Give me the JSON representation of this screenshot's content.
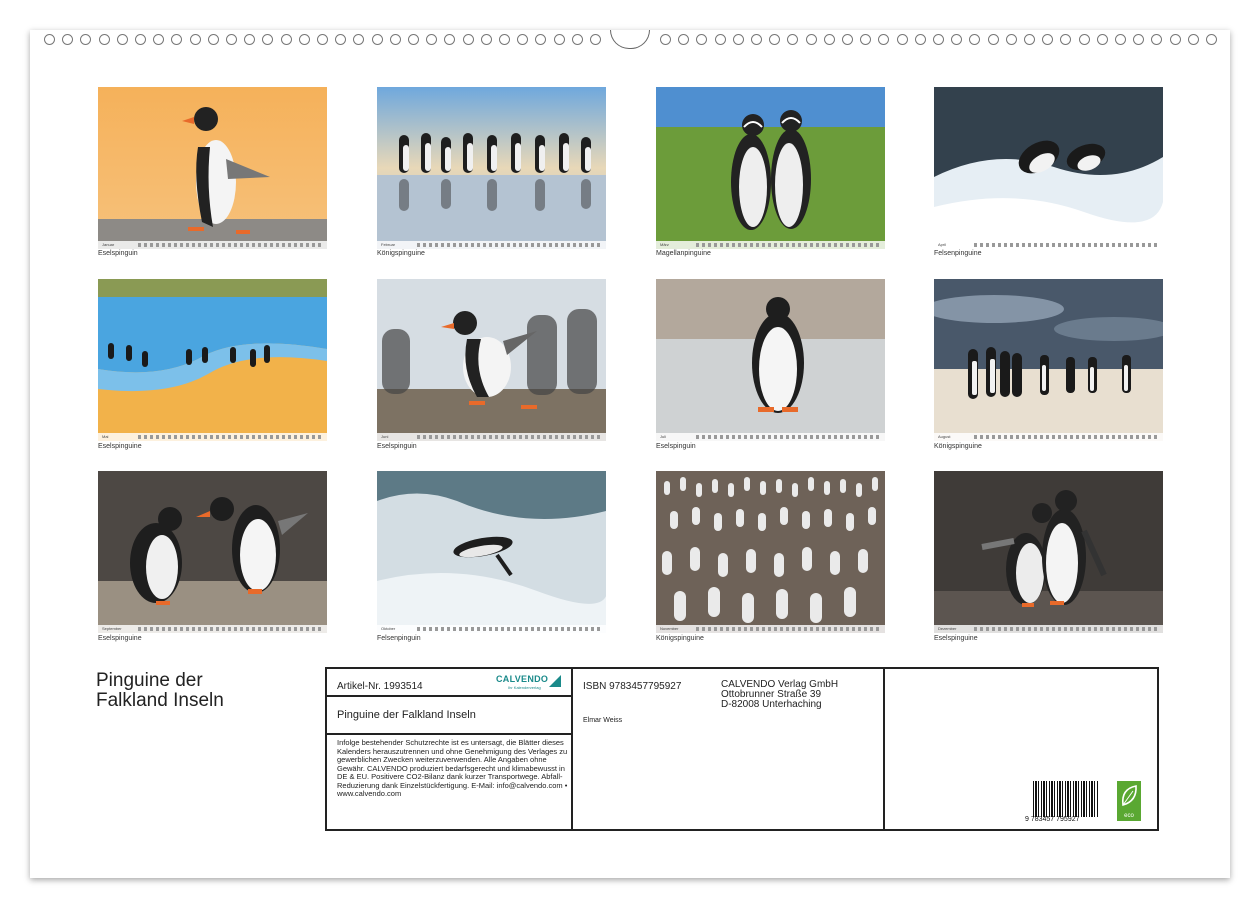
{
  "calendar": {
    "title_line1": "Pinguine der",
    "title_line2": "Falkland Inseln",
    "months": [
      {
        "caption": "Eselspinguin",
        "month": "Januar"
      },
      {
        "caption": "Königspinguine",
        "month": "Februar"
      },
      {
        "caption": "Magellanpinguine",
        "month": "März"
      },
      {
        "caption": "Felsenpinguine",
        "month": "April"
      },
      {
        "caption": "Eselspinguine",
        "month": "Mai"
      },
      {
        "caption": "Eselspinguin",
        "month": "Juni"
      },
      {
        "caption": "Eselspinguin",
        "month": "Juli"
      },
      {
        "caption": "Königspinguine",
        "month": "August"
      },
      {
        "caption": "Eselspinguine",
        "month": "September"
      },
      {
        "caption": "Felsenpinguin",
        "month": "Oktober"
      },
      {
        "caption": "Königspinguine",
        "month": "November"
      },
      {
        "caption": "Eselspinguine",
        "month": "Dezember"
      }
    ]
  },
  "info": {
    "article": "Artikel-Nr. 1993514",
    "brand": "CALVENDO",
    "brand_sub": "Ihr Kalenderverlag",
    "product_title": "Pinguine der Falkland Inseln",
    "legal": "Infolge bestehender Schutzrechte ist es untersagt, die Blätter dieses Kalenders herauszutrennen und ohne Genehmigung des Verlages zu gewerblichen Zwecken weiterzuverwenden. Alle Angaben ohne Gewähr. CALVENDO produziert bedarfsgerecht und klimabewusst in DE & EU. Positivere CO2-Bilanz dank kurzer Transportwege. Abfall-Reduzierung dank Einzelstückfertigung. E-Mail: info@calvendo.com • www.calvendo.com",
    "isbn": "ISBN 9783457795927",
    "author": "Elmar Weiss",
    "publisher_name": "CALVENDO Verlag GmbH",
    "publisher_street": "Ottobrunner Straße 39",
    "publisher_city": "D-82008 Unterhaching",
    "barcode_number": "9 783457 795927",
    "eco_label": "eco"
  },
  "colors": {
    "sheet": "#ffffff",
    "border": "#222222",
    "eco_green": "#5aa832",
    "brand_teal": "#1a8a8a"
  }
}
